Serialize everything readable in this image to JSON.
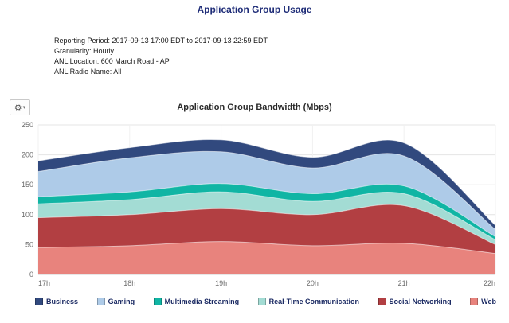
{
  "page": {
    "title": "Application Group Usage"
  },
  "meta": {
    "lines": [
      "Reporting Period: 2017-09-13 17:00 EDT to 2017-09-13 22:59 EDT",
      "Granularity: Hourly",
      "ANL Location: 600 March Road - AP",
      "ANL Radio Name: All"
    ]
  },
  "toolbar": {
    "options_gear": "⚙",
    "options_chevron": "▾"
  },
  "chart_data": {
    "type": "area",
    "stacked": true,
    "title": "Application Group Bandwidth (Mbps)",
    "xlabel": "",
    "ylabel": "",
    "x": [
      "17h",
      "18h",
      "19h",
      "20h",
      "21h",
      "22h"
    ],
    "ylim": [
      0,
      250
    ],
    "yticks": [
      0,
      50,
      100,
      150,
      200,
      250
    ],
    "grid": true,
    "legend_position": "bottom",
    "stack_order_bottom_to_top": [
      "Web",
      "Social Networking",
      "Real-Time Communication",
      "Multimedia Streaming",
      "Gaming",
      "Business"
    ],
    "series": [
      {
        "name": "Business",
        "color": "#31497e",
        "values": [
          18,
          17,
          20,
          18,
          22,
          7
        ]
      },
      {
        "name": "Gaming",
        "color": "#aecbe8",
        "values": [
          42,
          57,
          53,
          43,
          50,
          12
        ]
      },
      {
        "name": "Multimedia Streaming",
        "color": "#10b5a4",
        "values": [
          12,
          13,
          14,
          13,
          13,
          5
        ]
      },
      {
        "name": "Real-Time Communication",
        "color": "#a3dcd4",
        "values": [
          23,
          25,
          28,
          22,
          20,
          8
        ]
      },
      {
        "name": "Social Networking",
        "color": "#b23f42",
        "values": [
          50,
          52,
          55,
          52,
          63,
          15
        ]
      },
      {
        "name": "Web",
        "color": "#e8837d",
        "values": [
          45,
          48,
          55,
          48,
          52,
          35
        ]
      }
    ]
  }
}
